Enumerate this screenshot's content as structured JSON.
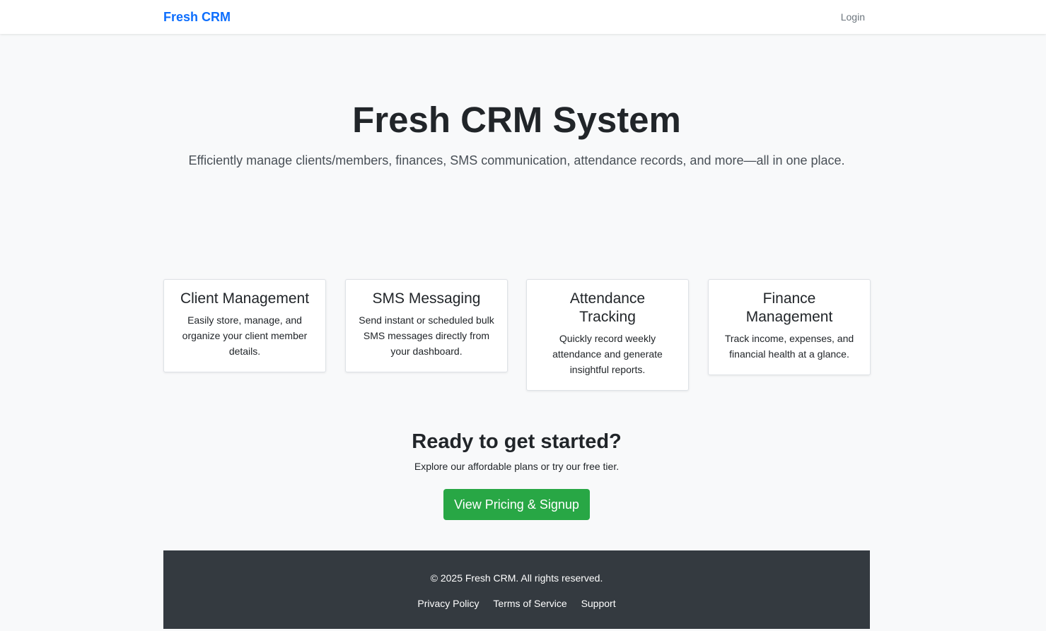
{
  "nav": {
    "brand": "Fresh CRM",
    "login": "Login"
  },
  "hero": {
    "title": "Fresh CRM System",
    "subtitle": "Efficiently manage clients/members, finances, SMS communication, attendance records, and more—all in one place."
  },
  "features": [
    {
      "title": "Client Management",
      "description": "Easily store, manage, and organize your client member details."
    },
    {
      "title": "SMS Messaging",
      "description": "Send instant or scheduled bulk SMS messages directly from your dashboard."
    },
    {
      "title": "Attendance Tracking",
      "description": "Quickly record weekly attendance and generate insightful reports."
    },
    {
      "title": "Finance Management",
      "description": "Track income, expenses, and financial health at a glance."
    }
  ],
  "cta": {
    "title": "Ready to get started?",
    "subtitle": "Explore our affordable plans or try our free tier.",
    "button": "View Pricing & Signup"
  },
  "footer": {
    "copyright": "© 2025 Fresh CRM. All rights reserved.",
    "links": [
      "Privacy Policy",
      "Terms of Service",
      "Support"
    ]
  },
  "colors": {
    "brand": "#0d6efd",
    "cta_button": "#28a745",
    "footer_bg": "#343a40",
    "page_bg": "#f8f9fa"
  }
}
